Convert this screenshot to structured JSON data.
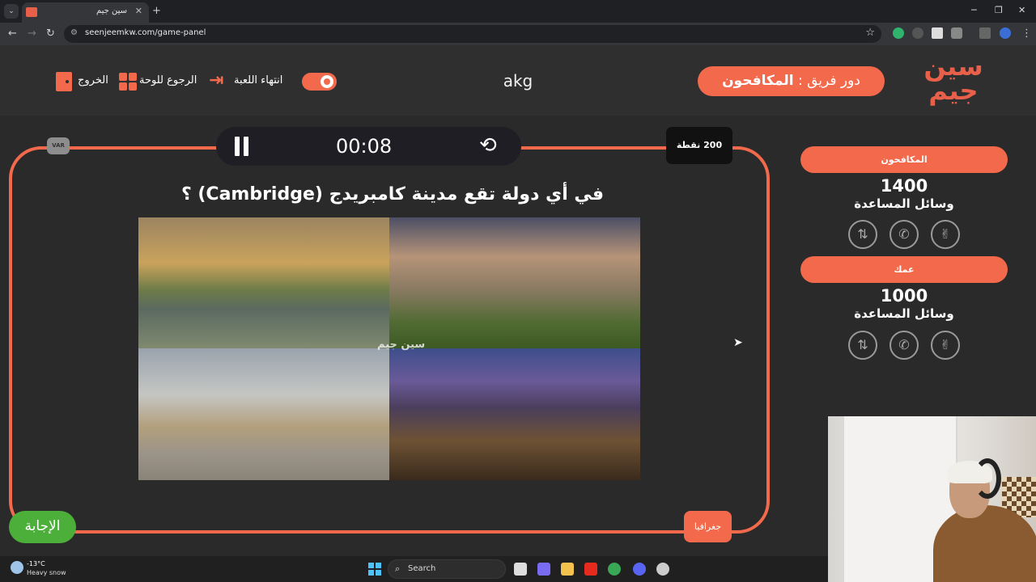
{
  "browser": {
    "tab_title": "سين جيم",
    "url": "seenjeemkw.com/game-panel"
  },
  "header": {
    "logo_text": "سين جيم",
    "turn_prefix": "دور فريق : ",
    "turn_team": "المكافحون",
    "player_name": "akg",
    "end_game_label": "انتهاء اللعبة",
    "back_to_board_label": "الرجوع للوحة",
    "exit_label": "الخروج"
  },
  "question_panel": {
    "timer": "00:08",
    "var_label": "VAR",
    "points": "200 نقطة",
    "question": "في أي دولة تقع مدينة كامبريدج (Cambridge) ؟",
    "watermark": "سين جيم",
    "category": "جغرافيا",
    "answer_button": "الإجابة"
  },
  "teams": [
    {
      "name": "المكافحون",
      "score": "1400",
      "helps_label": "وسائل المساعدة"
    },
    {
      "name": "عمك",
      "score": "1000",
      "helps_label": "وسائل المساعدة"
    }
  ],
  "taskbar": {
    "temperature": "-13°C",
    "weather": "Heavy snow",
    "search_placeholder": "Search"
  },
  "colors": {
    "accent": "#f26a4b",
    "answer": "#4caf3a",
    "background": "#2a2a2a"
  }
}
